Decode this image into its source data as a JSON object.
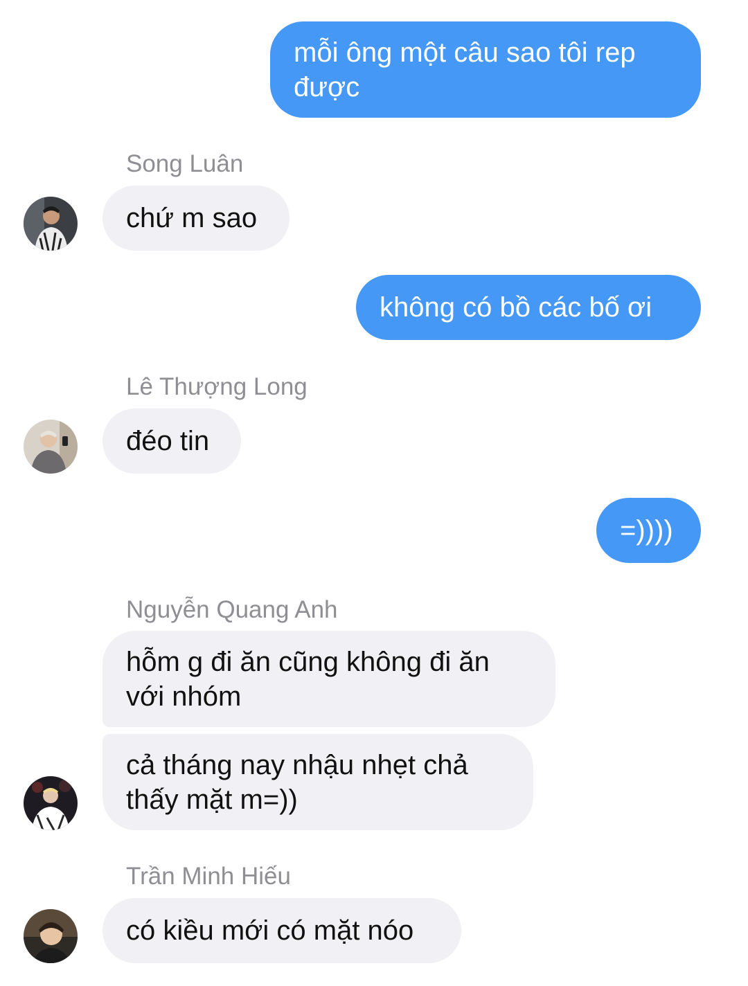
{
  "messages": {
    "m1": "mỗi ông một câu sao tôi rep được",
    "m2": "chứ m sao",
    "m3": "không có bồ các bố ơi",
    "m4": "đéo tin",
    "m5": "=))))",
    "m6": "hỗm g đi ăn cũng không đi ăn với nhóm",
    "m7": "cả tháng nay nhậu nhẹt chả thấy mặt m=))",
    "m8": "có kiều mới có mặt nóo"
  },
  "senders": {
    "s1": "Song Luân",
    "s2": "Lê Thượng Long",
    "s3": "Nguyễn Quang Anh",
    "s4": "Trần Minh Hiếu"
  },
  "colors": {
    "outgoing_bubble": "#4698f7",
    "incoming_bubble": "#f1f1f5",
    "sender_name": "#8e8e93"
  }
}
